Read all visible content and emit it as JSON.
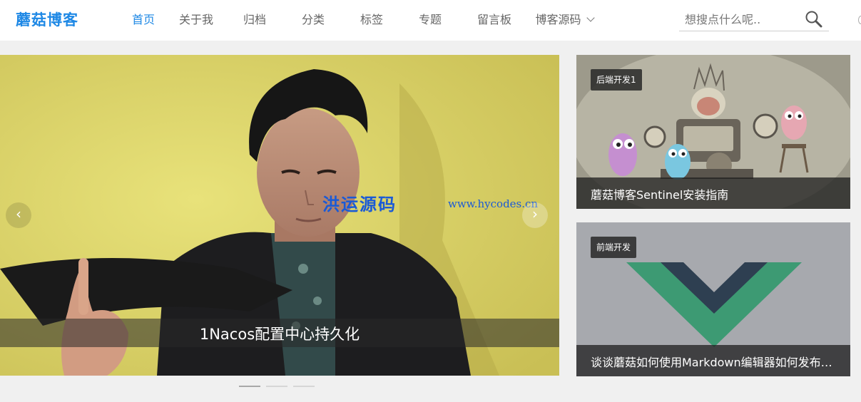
{
  "logo": "蘑菇博客",
  "nav": [
    {
      "label": "首页",
      "active": true
    },
    {
      "label": "关于我"
    },
    {
      "label": "归档"
    },
    {
      "label": "分类"
    },
    {
      "label": "标签"
    },
    {
      "label": "专题"
    },
    {
      "label": "留言板"
    },
    {
      "label": "博客源码",
      "dropdown": true
    }
  ],
  "search": {
    "placeholder": "想搜点什么呢.."
  },
  "carousel": {
    "caption": "1Nacos配置中心持久化",
    "watermark_cn": "洪运源码",
    "watermark_url": "www.hycodes.cn",
    "prev_icon": "‹",
    "next_icon": "›",
    "indicator_count": 3,
    "active_index": 0
  },
  "cards": [
    {
      "tag": "后端开发1",
      "title": "蘑菇博客Sentinel安装指南"
    },
    {
      "tag": "前端开发",
      "title": "谈谈蘑菇如何使用Markdown编辑器如何发布文章"
    }
  ],
  "colors": {
    "accent": "#1e88e5",
    "vue_green": "#41b883",
    "vue_dark": "#34495e"
  }
}
